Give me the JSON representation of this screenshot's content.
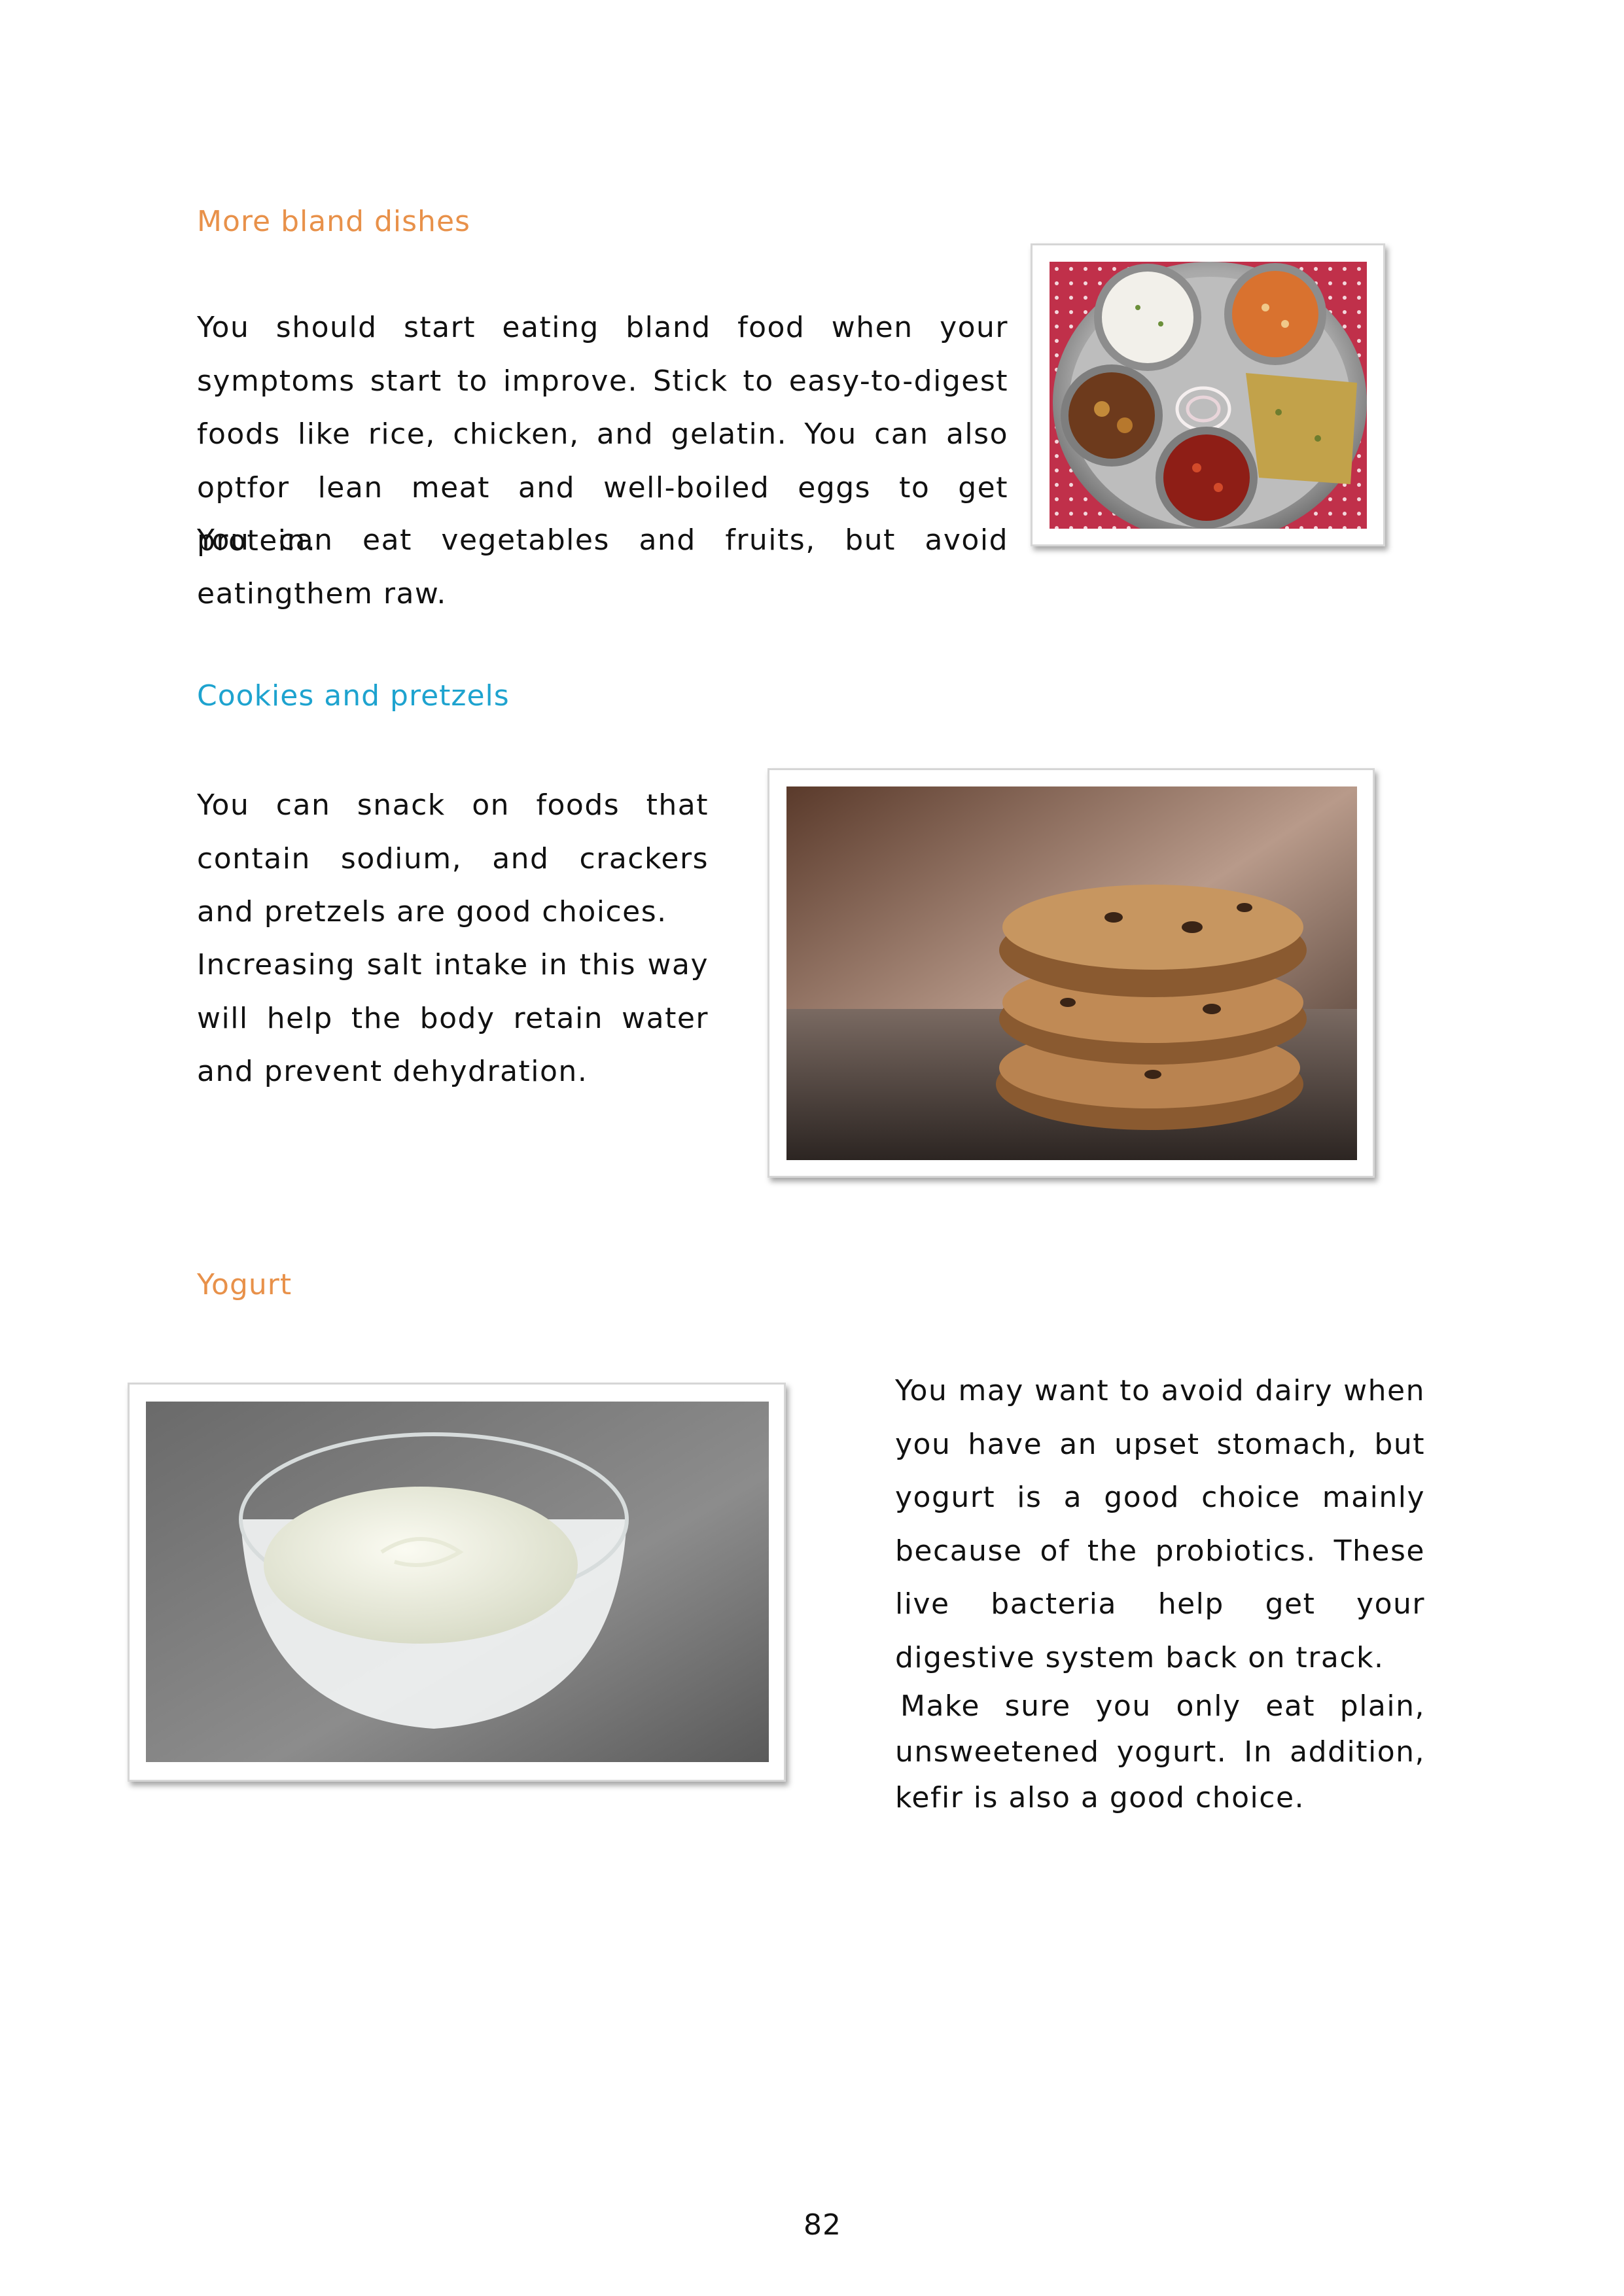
{
  "sections": [
    {
      "heading": "More bland dishes",
      "paragraphs": [
        "You should start eating bland food when your symptoms start to improve. Stick to easy-to-digest foods like rice, chicken, and gelatin. You can also optfor lean meat and well-boiled eggs to get protein.",
        "You can eat vegetables and fruits, but avoid eatingthem raw."
      ],
      "image_icon": "thali-plate-image"
    },
    {
      "heading": "Cookies and pretzels",
      "paragraphs": [
        "You can snack on foods that contain sodium, and crackers and pretzels are good choices.",
        "Increasing salt intake in this way will help the body retain water and prevent dehydration."
      ],
      "image_icon": "cookies-stack-image"
    },
    {
      "heading": "Yogurt",
      "paragraphs": [
        "You may want to avoid dairy when you have an upset stomach, but yogurt is a good choice mainly because of the probiotics. These live bacteria help get your digestive system back on track.",
        "Make sure you only eat plain, unsweetened yogurt. In addition, kefir is also a good choice."
      ],
      "image_icon": "yogurt-bowl-image"
    }
  ],
  "page_number": "82",
  "colors": {
    "heading_orange": "#e8914a",
    "heading_blue": "#1ea3cf",
    "text": "#111111"
  }
}
